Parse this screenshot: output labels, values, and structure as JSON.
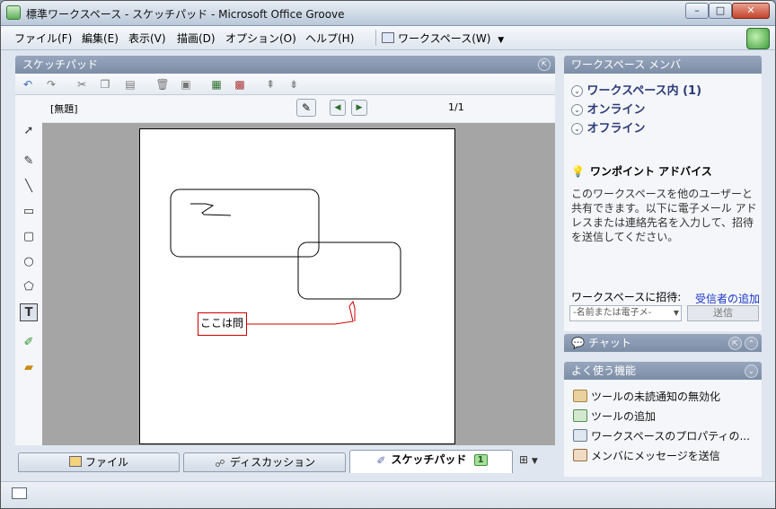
{
  "window": {
    "title": "標準ワークスペース - スケッチパッド - Microsoft Office Groove",
    "btn_min": "–",
    "btn_max": "□",
    "btn_close": "✕"
  },
  "menu": [
    "ファイル(F)",
    "編集(E)",
    "表示(V)",
    "描画(D)",
    "オプション(O)",
    "ヘルプ(H)"
  ],
  "workspace_menu": "ワークスペース(W)",
  "sketchpad": {
    "header": "スケッチパッド",
    "sketch_name": "[無題]",
    "page_indicator": "1/1",
    "note_text": "ここは問"
  },
  "tabs": [
    {
      "label": "ファイル",
      "icon": "file-tool-icon"
    },
    {
      "label": "ディスカッション",
      "icon": "discussion-icon"
    },
    {
      "label": "スケッチパッド",
      "icon": "sketchpad-icon",
      "badge": "1"
    }
  ],
  "members": {
    "header": "ワークスペース メンバ",
    "groups": [
      "ワークスペース内 (1)",
      "オンライン",
      "オフライン"
    ]
  },
  "tip": {
    "title": "ワンポイント アドバイス",
    "text": "このワークスペースを他のユーザーと共有できます。以下に電子メール アドレスまたは連絡先名を入力して、招待を送信してください。"
  },
  "invite": {
    "label": "ワークスペースに招待:",
    "add_link": "受信者の追加",
    "placeholder": "-名前または電子メ-",
    "send": "送信"
  },
  "chat": {
    "header": "チャット"
  },
  "common": {
    "header": "よく使う機能",
    "items": [
      "ツールの未読通知の無効化",
      "ツールの追加",
      "ワークスペースのプロパティの...",
      "メンバにメッセージを送信"
    ]
  },
  "colors": {
    "accent": "#2c3a78",
    "link": "#1a35c8",
    "annotation": "#cc0000"
  }
}
